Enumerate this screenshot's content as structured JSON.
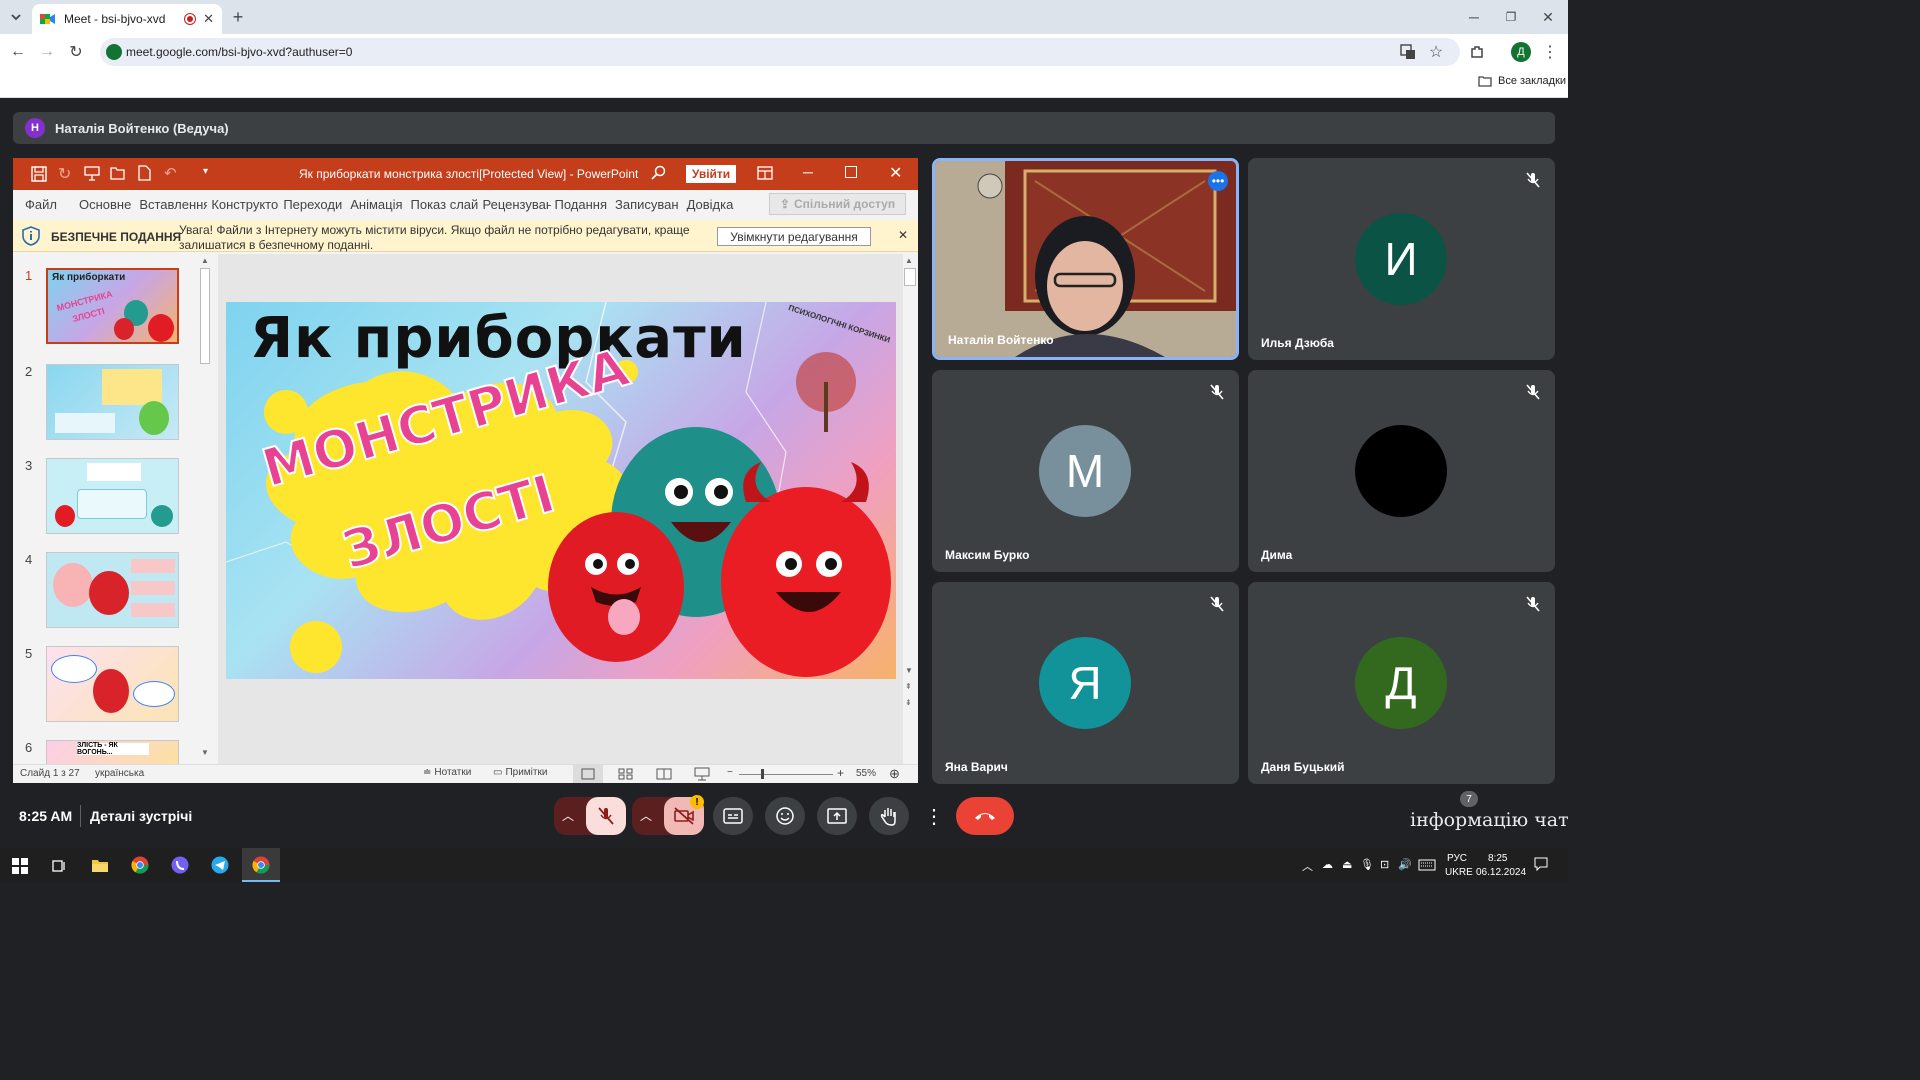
{
  "browser": {
    "tab_title": "Meet - bsi-bjvo-xvd",
    "url": "meet.google.com/bsi-bjvo-xvd?authuser=0",
    "bookmarks_label": "Все закладки",
    "profile_initial": "Д"
  },
  "meet": {
    "presenter_initial": "Н",
    "presenter_label": "Наталія Войтенко (Ведуча)",
    "time": "8:25 AM",
    "details_label": "Деталі зустрічі",
    "people_count": "7",
    "partial_caption": "інформацію чат кате"
  },
  "ppt": {
    "window_title": "Як приборкати монстрика злості[Protected View]  -  PowerPoint",
    "signin_label": "Увійти",
    "menu": [
      "Файл",
      "Основне",
      "Вставлення",
      "Конструкто",
      "Переходи",
      "Анімація",
      "Показ слай",
      "Рецензуван",
      "Подання",
      "Записуван",
      "Довідка"
    ],
    "share_label": "Спільний доступ",
    "warning_title": "БЕЗПЕЧНЕ ПОДАННЯ",
    "warning_text_1": "Увага! Файли з Інтернету можуть містити віруси. Якщо файл не потрібно редагувати, краще",
    "warning_text_2": "залишатися в безпечному поданні.",
    "enable_edit_label": "Увімкнути редагування",
    "slide_numbers": [
      "1",
      "2",
      "3",
      "4",
      "5",
      "6"
    ],
    "slide_title": "Як приборкати",
    "slide_subtitle_1": "МОНСТРИКА",
    "slide_subtitle_2": "ЗЛОСТІ",
    "slide_logo_text": "ПСИХОЛОГІЧНІ КОРЗИНКИ",
    "thumb1_line1": "Як приборкати",
    "thumb1_line2": "МОНСТРИКА",
    "thumb1_line3": "ЗЛОСТІ",
    "thumb6_text": "ЗЛІСТЬ - ЯК ВОГОНЬ...",
    "status_slide": "Слайд 1 з 27",
    "status_lang": "українська",
    "notes_label": "Нотатки",
    "comments_label": "Примітки",
    "zoom": "55%"
  },
  "participants": [
    {
      "name": "Наталія Войтенко",
      "initial": "",
      "color": "#000000",
      "video": true
    },
    {
      "name": "Илья Дзюба",
      "initial": "И",
      "color": "#0b5345"
    },
    {
      "name": "Максим Бурко",
      "initial": "М",
      "color": "#78909c"
    },
    {
      "name": "Дима",
      "initial": "",
      "color": "#000000"
    },
    {
      "name": "Яна Варич",
      "initial": "Я",
      "color": "#12939a"
    },
    {
      "name": "Даня Буцький",
      "initial": "Д",
      "color": "#33691e"
    }
  ],
  "taskbar": {
    "lang_1": "РУС",
    "lang_2": "UKRE",
    "clock_time": "8:25",
    "clock_date": "06.12.2024"
  },
  "colors": {
    "ppt_accent": "#c43e1c",
    "meet_bg": "#202124",
    "end_call": "#ea4335",
    "mic_off": "#f9dedc"
  }
}
